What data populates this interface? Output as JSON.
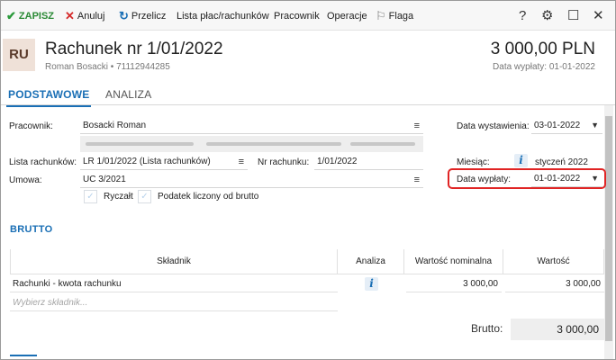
{
  "toolbar": {
    "save": "ZAPISZ",
    "cancel": "Anuluj",
    "recalc": "Przelicz",
    "payroll_list": "Lista płac/rachunków",
    "employee": "Pracownik",
    "operations": "Operacje",
    "flag": "Flaga",
    "help": "?",
    "settings": "⚙",
    "maximize": "☐",
    "close": "✕"
  },
  "header": {
    "badge": "RU",
    "title": "Rachunek nr 1/01/2022",
    "subtitle": "Roman Bosacki • 71112944285",
    "amount": "3 000,00 PLN",
    "payment_date": "Data wypłaty: 01-01-2022"
  },
  "tabs": {
    "basic": "PODSTAWOWE",
    "analysis": "ANALIZA"
  },
  "form": {
    "employee_label": "Pracownik:",
    "employee_value": "Bosacki Roman",
    "list_label": "Lista rachunków:",
    "list_value": "LR 1/01/2022 (Lista rachunków)",
    "bill_no_label": "Nr rachunku:",
    "bill_no_value": "1/01/2022",
    "contract_label": "Umowa:",
    "contract_value": "UC 3/2021",
    "lump_sum": "Ryczałt",
    "gross_tax": "Podatek liczony od brutto",
    "issue_date_label": "Data wystawienia:",
    "issue_date_value": "03-01-2022",
    "month_label": "Miesiąc:",
    "month_value": "styczeń 2022",
    "pay_date_label": "Data wypłaty:",
    "pay_date_value": "01-01-2022"
  },
  "brutto": {
    "section_title": "BRUTTO",
    "columns": [
      "Składnik",
      "Analiza",
      "Wartość nominalna",
      "Wartość"
    ],
    "row": {
      "component": "Rachunki - kwota rachunku",
      "nominal": "3 000,00",
      "value": "3 000,00"
    },
    "placeholder": "Wybierz składnik...",
    "total_label": "Brutto:",
    "total_value": "3 000,00"
  }
}
